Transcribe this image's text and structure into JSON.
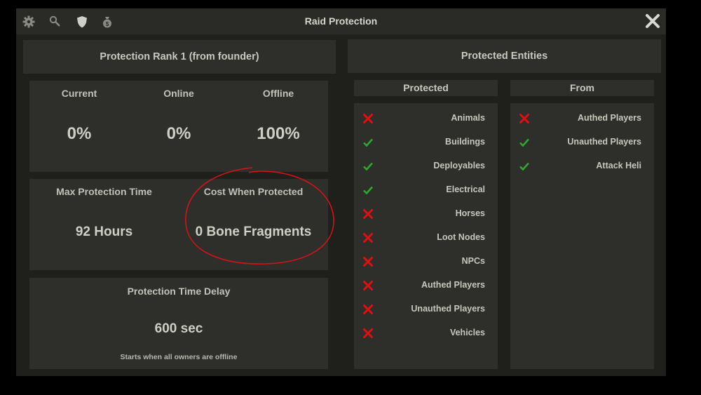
{
  "window": {
    "title": "Raid Protection",
    "icons": [
      "gear-icon",
      "search-icon",
      "shield-icon",
      "money-bag-icon",
      "close-icon"
    ]
  },
  "rank": {
    "label": "Protection Rank 1 (from founder)"
  },
  "stats": {
    "current_label": "Current",
    "current_value": "0%",
    "online_label": "Online",
    "online_value": "0%",
    "offline_label": "Offline",
    "offline_value": "100%"
  },
  "max_time": {
    "label": "Max Protection Time",
    "value": "92 Hours"
  },
  "cost": {
    "label": "Cost When Protected",
    "value": "0 Bone Fragments"
  },
  "delay": {
    "label": "Protection Time Delay",
    "value": "600 sec",
    "note": "Starts when all owners are offline"
  },
  "entities": {
    "header": "Protected Entities",
    "protected_header": "Protected",
    "from_header": "From",
    "protected": [
      {
        "label": "Animals",
        "enabled": false
      },
      {
        "label": "Buildings",
        "enabled": true
      },
      {
        "label": "Deployables",
        "enabled": true
      },
      {
        "label": "Electrical",
        "enabled": true
      },
      {
        "label": "Horses",
        "enabled": false
      },
      {
        "label": "Loot Nodes",
        "enabled": false
      },
      {
        "label": "NPCs",
        "enabled": false
      },
      {
        "label": "Authed Players",
        "enabled": false
      },
      {
        "label": "Unauthed Players",
        "enabled": false
      },
      {
        "label": "Vehicles",
        "enabled": false
      }
    ],
    "from": [
      {
        "label": "Authed Players",
        "enabled": false
      },
      {
        "label": "Unauthed Players",
        "enabled": true
      },
      {
        "label": "Attack Heli",
        "enabled": true
      }
    ]
  },
  "colors": {
    "check": "#2ea82e",
    "cross": "#e01010",
    "annotation": "#d41414"
  }
}
